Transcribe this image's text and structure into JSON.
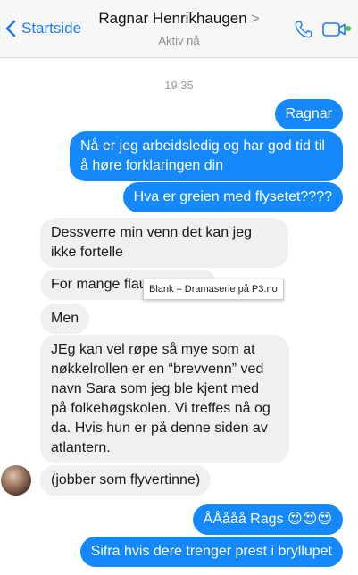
{
  "header": {
    "back_label": "Startside",
    "contact_name": "Ragnar Henrikhaugen",
    "contact_chevron": ">",
    "status": "Aktiv nå",
    "accent_color": "#1f7cf6",
    "icons": [
      "chevron-left-icon",
      "phone-icon",
      "video-camera-icon"
    ]
  },
  "conversation": {
    "timestamp": "19:35",
    "messages": [
      {
        "from": "me",
        "text": "Ragnar"
      },
      {
        "from": "me",
        "text": "Nå er jeg arbeidsledig og har god tid til å høre forklaringen din"
      },
      {
        "from": "me",
        "text": "Hva er greien med flysetet????"
      },
      {
        "from": "them",
        "text": "Dessverre min venn det kan jeg ikke fortelle"
      },
      {
        "from": "them",
        "text": "For mange flau"
      },
      {
        "from": "them",
        "text": "Men"
      },
      {
        "from": "them",
        "text": "JEg kan vel røpe så mye som at nøkkelrollen er en “brevvenn” ved navn Sara som jeg ble kjent med på folkehøgskolen. Vi treffes nå og da. Hvis hun er på denne siden av atlantern."
      },
      {
        "from": "them",
        "text": "(jobber som flyvertinne)"
      },
      {
        "from": "me",
        "text": "ÅÅååå Rags 😍😍😍"
      },
      {
        "from": "me",
        "text": "Sifra hvis dere trenger prest i bryllupet"
      }
    ],
    "tooltip": "Blank – Dramaserie på P3.no",
    "outgoing_color": "#1588fb",
    "incoming_color": "#f0f0f0"
  }
}
